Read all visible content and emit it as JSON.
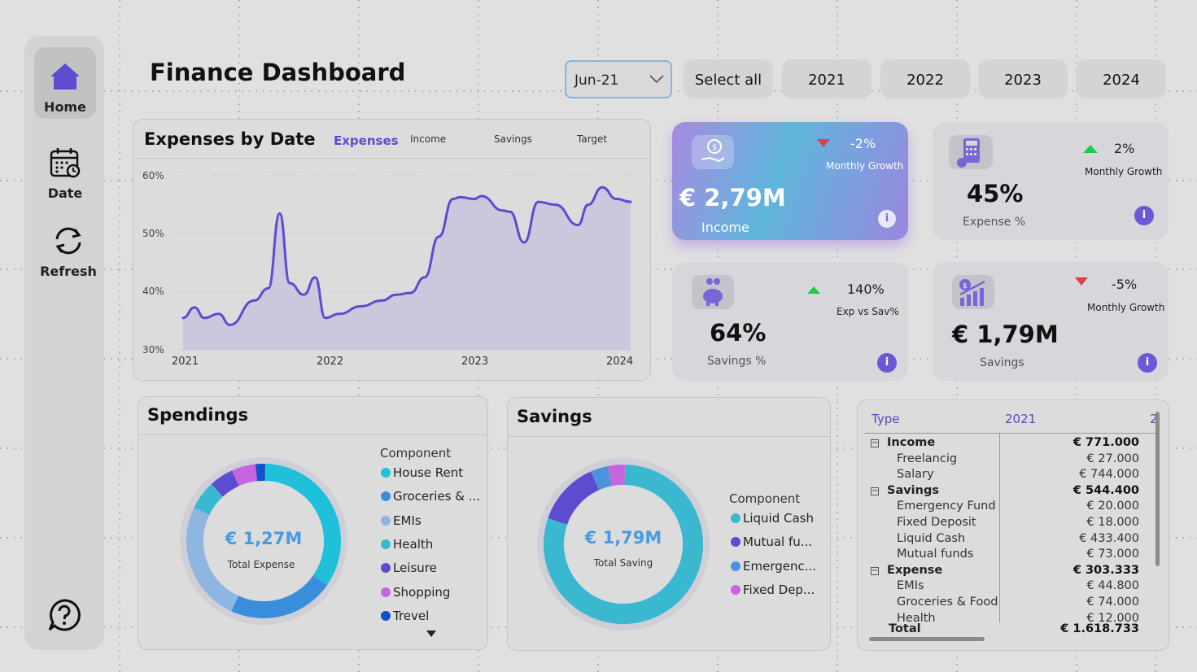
{
  "nav": {
    "home": "Home",
    "date": "Date",
    "refresh": "Refresh"
  },
  "header": {
    "title": "Finance Dashboard",
    "dropdown_value": "Jun-21",
    "slicers": [
      "Select all",
      "2021",
      "2022",
      "2023",
      "2024"
    ]
  },
  "expenses_chart": {
    "title": "Expenses by Date",
    "tabs": [
      "Expenses",
      "Income",
      "Savings",
      "Target"
    ],
    "active_tab": "Expenses",
    "y_ticks": [
      "60%",
      "50%",
      "40%",
      "30%"
    ],
    "x_ticks": [
      "2021",
      "2022",
      "2023",
      "2024"
    ]
  },
  "chart_data": {
    "type": "area",
    "title": "Expenses by Date",
    "ylim": [
      30,
      60
    ],
    "x": [
      2021.0,
      2021.08,
      2021.15,
      2021.25,
      2021.33,
      2021.5,
      2021.6,
      2021.68,
      2021.75,
      2021.85,
      2021.93,
      2022.0,
      2022.1,
      2022.25,
      2022.4,
      2022.5,
      2022.6,
      2022.7,
      2022.8,
      2022.9,
      2022.95,
      2023.05,
      2023.1,
      2023.25,
      2023.3,
      2023.4,
      2023.5,
      2023.62,
      2023.78,
      2023.85,
      2023.95,
      2024.05,
      2024.15
    ],
    "series": [
      {
        "values": [
          35.5,
          37.3,
          35.5,
          36.2,
          34.3,
          38.5,
          40.6,
          53.5,
          41.5,
          39.5,
          42.5,
          35.5,
          36.2,
          37.5,
          38.5,
          39.5,
          39.8,
          42.5,
          49.5,
          56.0,
          56.3,
          56.0,
          56.5,
          54.0,
          53.8,
          48.5,
          55.5,
          55.0,
          51.5,
          55.0,
          58.0,
          56.0,
          55.5
        ]
      }
    ],
    "grid": true
  },
  "kpis": {
    "income": {
      "value": "€ 2,79M",
      "label": "Income",
      "growth": "-2%",
      "growth_label": "Monthly Growth"
    },
    "expense": {
      "value": "45%",
      "label": "Expense %",
      "growth": "2%",
      "growth_label": "Monthly Growth"
    },
    "savings_pct": {
      "value": "64%",
      "label": "Savings %",
      "growth": "140%",
      "growth_label": "Exp vs Sav%"
    },
    "savings": {
      "value": "€ 1,79M",
      "label": "Savings",
      "growth": "-5%",
      "growth_label": "Monthly Growth"
    }
  },
  "info_icon": "i",
  "spendings": {
    "title": "Spendings",
    "center_value": "€ 1,27M",
    "center_label": "Total Expense",
    "legend_title": "Component",
    "legend": [
      {
        "label": "House Rent",
        "color": "#1ec0da"
      },
      {
        "label": "Groceries & ...",
        "color": "#3a8fdc"
      },
      {
        "label": "EMIs",
        "color": "#8fb6e0"
      },
      {
        "label": "Health",
        "color": "#3ab8d0"
      },
      {
        "label": "Leisure",
        "color": "#5b4cd0"
      },
      {
        "label": "Shopping",
        "color": "#c565e0"
      },
      {
        "label": "Trevel",
        "color": "#1450c8"
      }
    ],
    "slices": [
      0.34,
      0.22,
      0.25,
      0.06,
      0.05,
      0.05,
      0.02
    ]
  },
  "savings_donut": {
    "title": "Savings",
    "center_value": "€ 1,79M",
    "center_label": "Total Saving",
    "legend_title": "Component",
    "legend": [
      {
        "label": "Liquid Cash",
        "color": "#3ab8d0"
      },
      {
        "label": "Mutual fu...",
        "color": "#5b4cd0"
      },
      {
        "label": "Emergenc...",
        "color": "#4a94dc"
      },
      {
        "label": "Fixed Dep...",
        "color": "#c565e0"
      }
    ],
    "slices": [
      0.8,
      0.13,
      0.035,
      0.035
    ]
  },
  "matrix": {
    "col_type": "Type",
    "col_year": "2021",
    "rows": [
      {
        "name": "Income",
        "value": "€ 771.000",
        "group": true
      },
      {
        "name": "Freelancig",
        "value": "€ 27.000"
      },
      {
        "name": "Salary",
        "value": "€ 744.000"
      },
      {
        "name": "Savings",
        "value": "€ 544.400",
        "group": true
      },
      {
        "name": "Emergency Fund",
        "value": "€ 20.000"
      },
      {
        "name": "Fixed Deposit",
        "value": "€ 18.000"
      },
      {
        "name": "Liquid Cash",
        "value": "€ 433.400"
      },
      {
        "name": "Mutual funds",
        "value": "€ 73.000"
      },
      {
        "name": "Expense",
        "value": "€ 303.333",
        "group": true
      },
      {
        "name": "EMIs",
        "value": "€ 44.800"
      },
      {
        "name": "Groceries & Food",
        "value": "€ 74.000"
      },
      {
        "name": "Health",
        "value": "€ 12.000"
      }
    ],
    "total_label": "Total",
    "total_value": "€ 1.618.733"
  }
}
